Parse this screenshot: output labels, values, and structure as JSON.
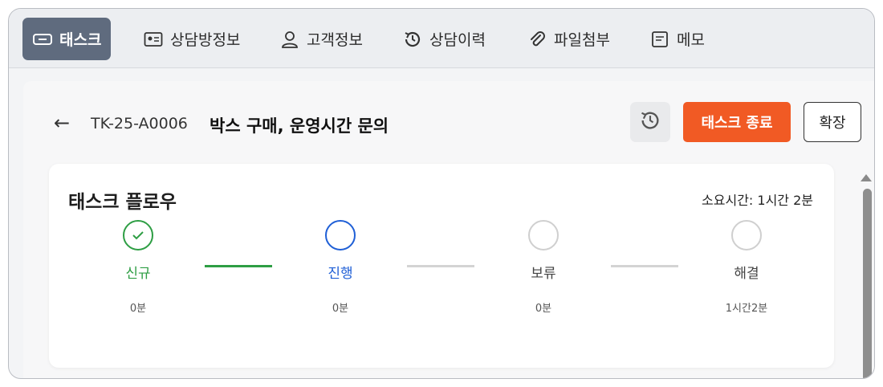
{
  "tabs": [
    {
      "label": "태스크",
      "icon": "ticket-icon",
      "active": true
    },
    {
      "label": "상담방정보",
      "icon": "id-card-icon",
      "active": false
    },
    {
      "label": "고객정보",
      "icon": "user-icon",
      "active": false
    },
    {
      "label": "상담이력",
      "icon": "history-icon",
      "active": false
    },
    {
      "label": "파일첨부",
      "icon": "paperclip-icon",
      "active": false
    },
    {
      "label": "메모",
      "icon": "memo-icon",
      "active": false
    }
  ],
  "header": {
    "back_arrow": "←",
    "task_id": "TK-25-A0006",
    "task_title": "박스 구매, 운영시간 문의",
    "history_icon": "history-icon",
    "end_task_label": "태스크 종료",
    "expand_label": "확장"
  },
  "flow": {
    "title": "태스크 플로우",
    "elapsed": "소요시간: 1시간 2분",
    "steps": [
      {
        "label": "신규",
        "duration": "0분",
        "state": "done"
      },
      {
        "label": "진행",
        "duration": "0분",
        "state": "current"
      },
      {
        "label": "보류",
        "duration": "0분",
        "state": "pending"
      },
      {
        "label": "해결",
        "duration": "1시간2분",
        "state": "pending"
      }
    ]
  },
  "colors": {
    "active_tab": "#5f6b7e",
    "end_button": "#f15a24",
    "done": "#2e9e44",
    "current": "#1f5fd6"
  }
}
